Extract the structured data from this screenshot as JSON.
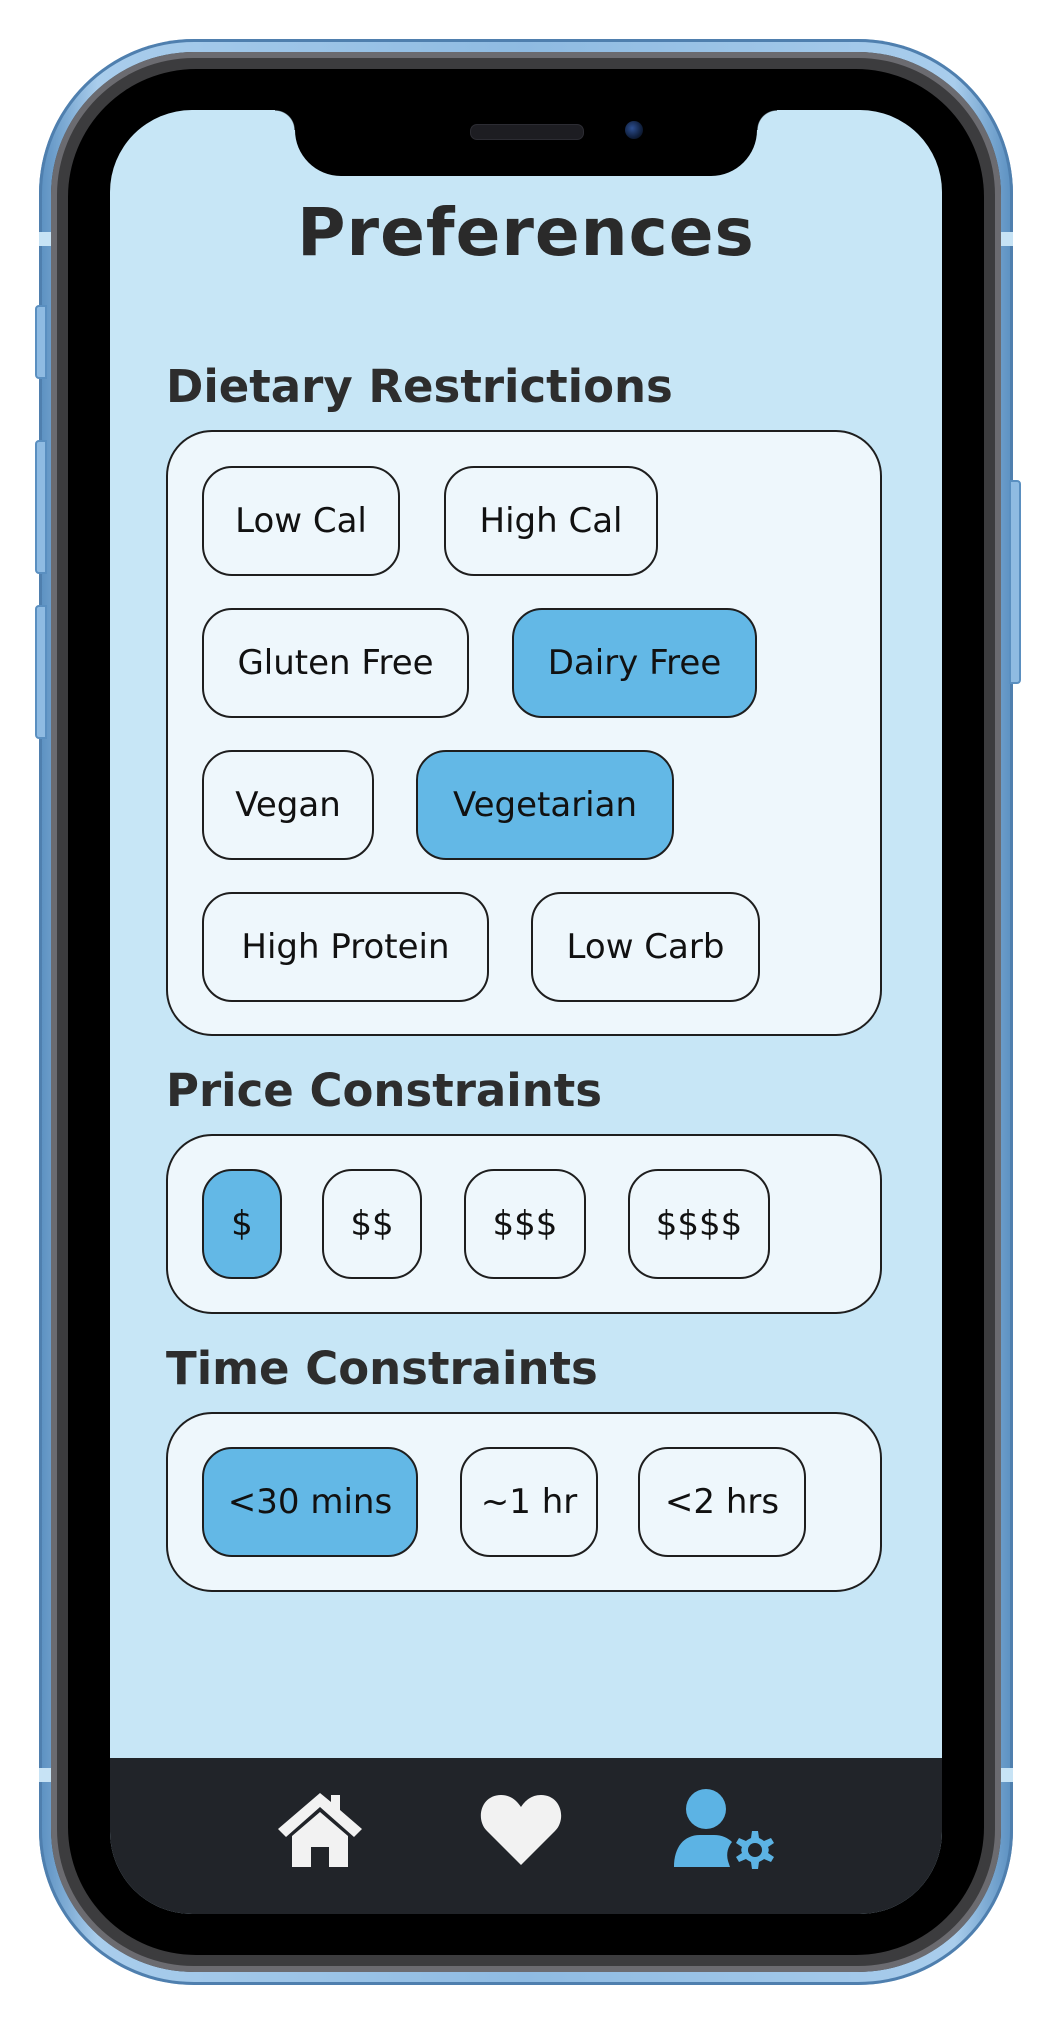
{
  "header": {
    "title": "Preferences"
  },
  "dietary": {
    "title": "Dietary Restrictions",
    "options": [
      {
        "label": "Low Cal",
        "selected": false
      },
      {
        "label": "High Cal",
        "selected": false
      },
      {
        "label": "Gluten Free",
        "selected": false
      },
      {
        "label": "Dairy Free",
        "selected": true
      },
      {
        "label": "Vegan",
        "selected": false
      },
      {
        "label": "Vegetarian",
        "selected": true
      },
      {
        "label": "High Protein",
        "selected": false
      },
      {
        "label": "Low Carb",
        "selected": false
      }
    ]
  },
  "price": {
    "title": "Price Constraints",
    "options": [
      {
        "label": "$",
        "selected": true
      },
      {
        "label": "$$",
        "selected": false
      },
      {
        "label": "$$$",
        "selected": false
      },
      {
        "label": "$$$$",
        "selected": false
      }
    ]
  },
  "time": {
    "title": "Time Constraints",
    "options": [
      {
        "label": "<30 mins",
        "selected": true
      },
      {
        "label": "~1 hr",
        "selected": false
      },
      {
        "label": "<2 hrs",
        "selected": false
      }
    ]
  },
  "nav": {
    "items": [
      {
        "icon": "home-icon",
        "active": false
      },
      {
        "icon": "heart-icon",
        "active": false
      },
      {
        "icon": "user-settings-icon",
        "active": true
      }
    ]
  },
  "colors": {
    "screen_bg": "#c7e6f6",
    "card_bg": "#eef7fc",
    "selected_chip": "#63b8e6",
    "nav_bg": "#212429",
    "nav_icon": "#f2f2f2",
    "nav_icon_active": "#5cb3e4",
    "frame": "#8fbbe2"
  }
}
